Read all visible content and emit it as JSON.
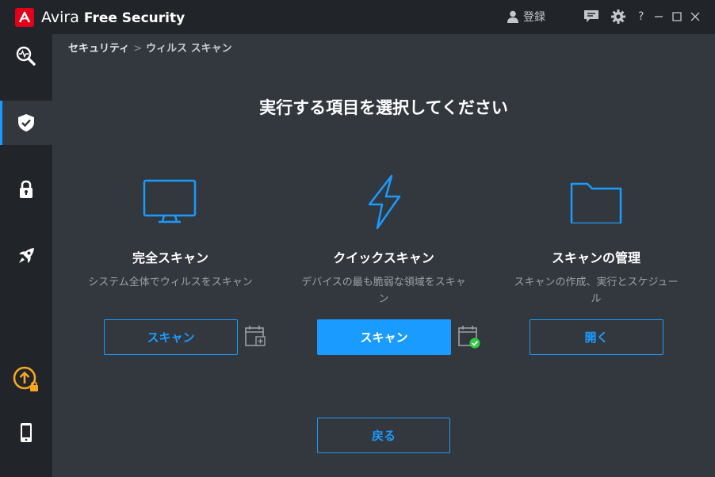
{
  "app": {
    "brand_light": "Avira",
    "brand_bold": "Free Security",
    "register_label": "登録",
    "help_label": "?"
  },
  "breadcrumb": {
    "parent": "セキュリティ",
    "separator": ">",
    "current": "ウィルス スキャン"
  },
  "heading": "実行する項目を選択してください",
  "cards": [
    {
      "title": "完全スキャン",
      "desc": "システム全体でウィルスをスキャン",
      "button": "スキャン",
      "icon": "monitor-icon"
    },
    {
      "title": "クイックスキャン",
      "desc": "デバイスの最も脆弱な領域をスキャン",
      "button": "スキャン",
      "icon": "lightning-icon"
    },
    {
      "title": "スキャンの管理",
      "desc": "スキャンの作成、実行とスケジュール",
      "button": "開く",
      "icon": "folder-icon"
    }
  ],
  "back_label": "戻る",
  "sidebar": [
    {
      "name": "status-scan",
      "icon": "magnifier-pulse-icon"
    },
    {
      "name": "security",
      "icon": "shield-check-icon",
      "active": true
    },
    {
      "name": "privacy",
      "icon": "lock-icon"
    },
    {
      "name": "performance",
      "icon": "rocket-icon"
    },
    {
      "name": "upgrade",
      "icon": "upgrade-arrow-icon"
    },
    {
      "name": "mobile",
      "icon": "phone-icon"
    }
  ],
  "colors": {
    "accent": "#1a9bff",
    "background": "#33383f",
    "sidebar": "#212529",
    "brand_red": "#e2001a",
    "upgrade_orange": "#f5a623",
    "check_green": "#2ecc40"
  }
}
